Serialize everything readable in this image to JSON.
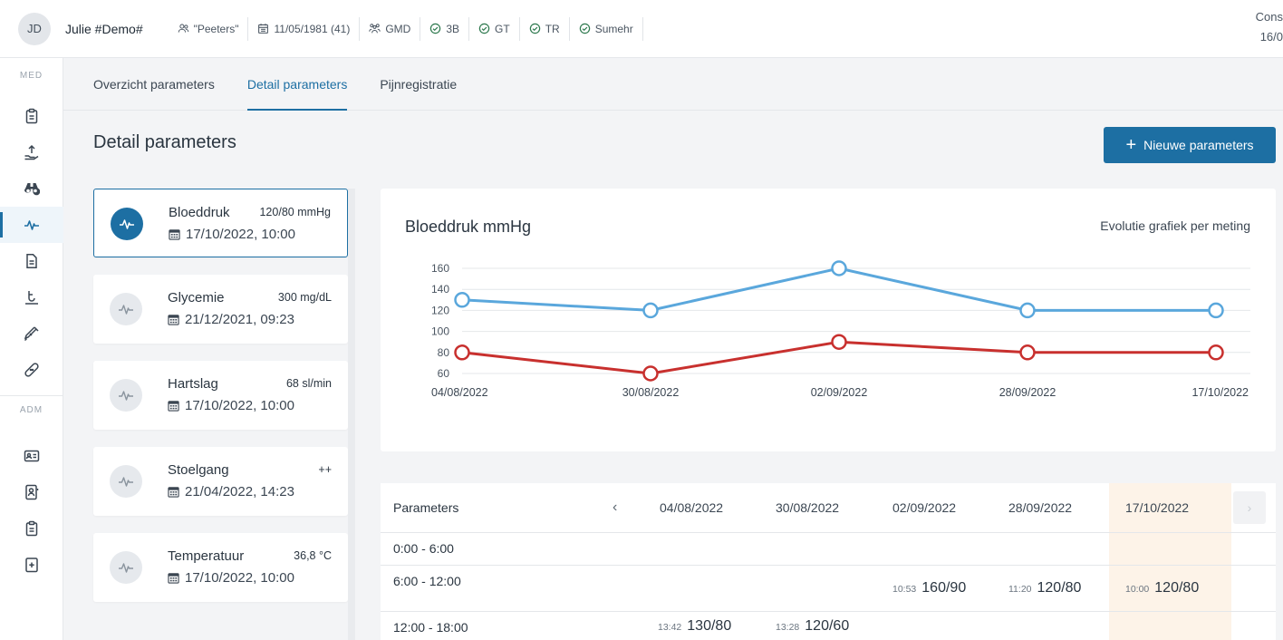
{
  "header": {
    "avatar_initials": "JD",
    "patient_name": "Julie #Demo#",
    "chips": [
      {
        "icon": "people-icon",
        "label": "\"Peeters\""
      },
      {
        "icon": "calendar-icon",
        "label": "11/05/1981 (41)"
      },
      {
        "icon": "group-icon",
        "label": "GMD"
      },
      {
        "icon": "check-circle-icon",
        "label": "3B"
      },
      {
        "icon": "check-circle-icon",
        "label": "GT"
      },
      {
        "icon": "check-circle-icon",
        "label": "TR"
      },
      {
        "icon": "check-circle-icon",
        "label": "Sumehr"
      }
    ],
    "right_line1": "Cons",
    "right_line2": "16/0"
  },
  "sidebar": {
    "section_med": "MED",
    "section_adm": "ADM",
    "med_icons": [
      "clipboard-icon",
      "hand-upload-icon",
      "binoculars-icon",
      "pulse-icon",
      "document-icon",
      "scale-icon",
      "syringe-icon",
      "bandage-icon"
    ],
    "adm_icons": [
      "id-card-icon",
      "contact-card-icon",
      "clipboard-icon",
      "document-plus-icon"
    ],
    "active_index": 3
  },
  "tabs": [
    {
      "label": "Overzicht parameters",
      "active": false
    },
    {
      "label": "Detail parameters",
      "active": true
    },
    {
      "label": "Pijnregistratie",
      "active": false
    }
  ],
  "page_title": "Detail parameters",
  "new_button": {
    "icon": "plus-icon",
    "label": "Nieuwe parameters"
  },
  "parameters": [
    {
      "name": "Bloeddruk",
      "value": "120/80 mmHg",
      "date": "17/10/2022, 10:00",
      "selected": true
    },
    {
      "name": "Glycemie",
      "value": "300 mg/dL",
      "date": "21/12/2021, 09:23",
      "selected": false
    },
    {
      "name": "Hartslag",
      "value": "68 sl/min",
      "date": "17/10/2022, 10:00",
      "selected": false
    },
    {
      "name": "Stoelgang",
      "value": "++",
      "date": "21/04/2022, 14:23",
      "selected": false
    },
    {
      "name": "Temperatuur",
      "value": "36,8 °C",
      "date": "17/10/2022, 10:00",
      "selected": false
    }
  ],
  "chart": {
    "title": "Bloeddruk mmHg",
    "subtitle": "Evolutie grafiek per meting",
    "colors": {
      "systolic": "#5aa7dc",
      "diastolic": "#c8302e",
      "grid": "#e4e7ea"
    }
  },
  "chart_data": {
    "type": "line",
    "x": [
      "04/08/2022",
      "30/08/2022",
      "02/09/2022",
      "28/09/2022",
      "17/10/2022"
    ],
    "ylim": [
      60,
      160
    ],
    "yticks": [
      60,
      80,
      100,
      120,
      140,
      160
    ],
    "series": [
      {
        "values": [
          130,
          120,
          160,
          120,
          120
        ]
      },
      {
        "values": [
          80,
          60,
          90,
          80,
          80
        ]
      }
    ]
  },
  "table": {
    "header_label": "Parameters",
    "nav_prev": "‹",
    "nav_next": "›",
    "dates": [
      "04/08/2022",
      "30/08/2022",
      "02/09/2022",
      "28/09/2022",
      "17/10/2022"
    ],
    "rows": [
      {
        "label": "0:00 - 6:00",
        "cells": []
      },
      {
        "label": "6:00 - 12:00",
        "cells": [
          {
            "col": 2,
            "time": "10:53",
            "value": "160/90"
          },
          {
            "col": 3,
            "time": "11:20",
            "value": "120/80"
          },
          {
            "col": 4,
            "time": "10:00",
            "value": "120/80"
          }
        ]
      },
      {
        "label": "12:00 - 18:00",
        "cells": [
          {
            "col": 0,
            "time": "13:42",
            "value": "130/80"
          },
          {
            "col": 1,
            "time": "13:28",
            "value": "120/60"
          }
        ]
      }
    ]
  }
}
